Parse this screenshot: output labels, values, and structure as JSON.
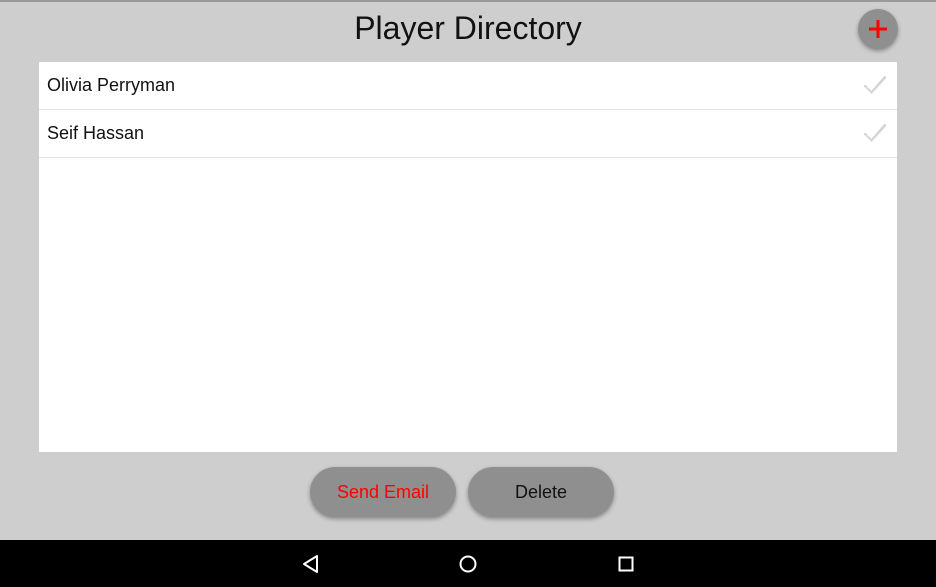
{
  "header": {
    "title": "Player Directory",
    "add_icon": "plus-icon"
  },
  "players": [
    {
      "name": "Olivia Perryman",
      "checked": false
    },
    {
      "name": "Seif Hassan",
      "checked": false
    }
  ],
  "actions": {
    "send_email_label": "Send Email",
    "delete_label": "Delete"
  },
  "navbar": {
    "back_icon": "back-triangle-icon",
    "home_icon": "home-circle-icon",
    "recents_icon": "recents-square-icon"
  },
  "colors": {
    "background": "#cecece",
    "accent_red": "#ff0000",
    "button_gray": "#8f8f8f",
    "check_gray": "#d0d0d0"
  }
}
